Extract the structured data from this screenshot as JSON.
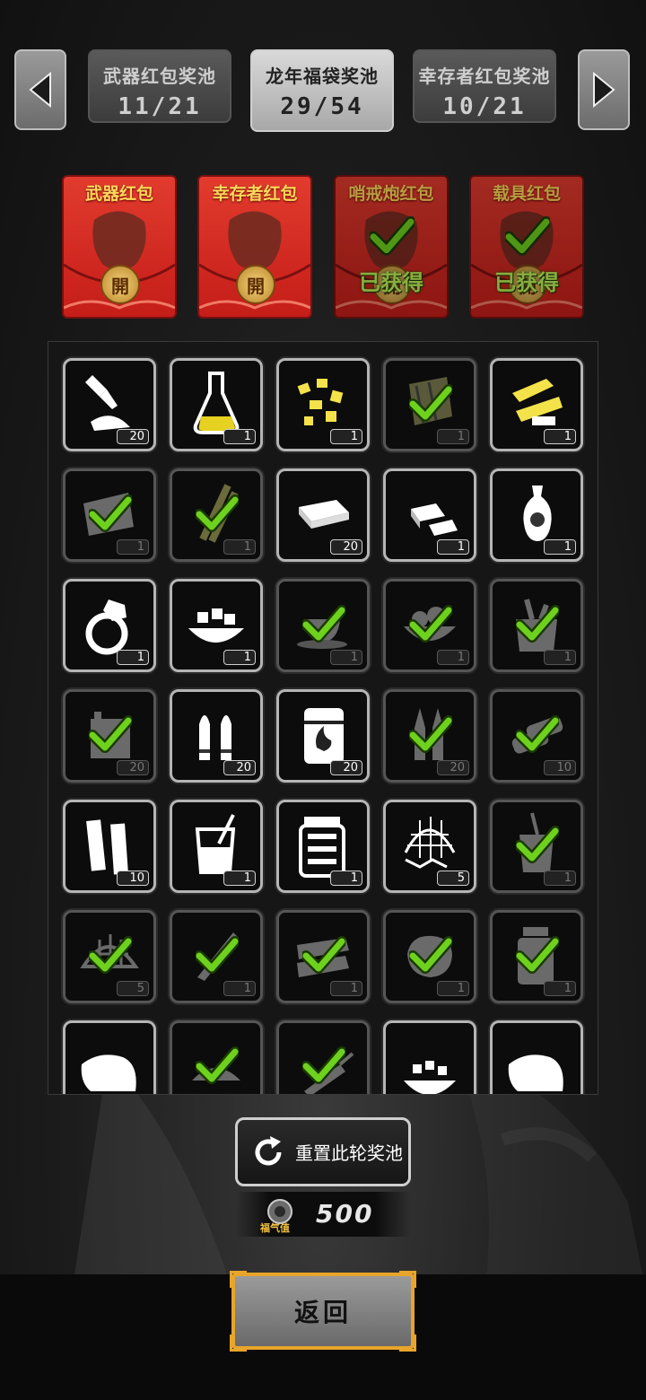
{
  "pools": [
    {
      "name": "武器红包奖池",
      "count": "11/21",
      "active": false
    },
    {
      "name": "龙年福袋奖池",
      "count": "29/54",
      "active": true
    },
    {
      "name": "幸存者红包奖池",
      "count": "10/21",
      "active": false
    }
  ],
  "envelopes": [
    {
      "title": "武器红包",
      "seal": "開",
      "claimed": false
    },
    {
      "title": "幸存者红包",
      "seal": "開",
      "claimed": false
    },
    {
      "title": "哨戒炮红包",
      "seal": "開",
      "claimed": true,
      "claimed_label": "已获得"
    },
    {
      "title": "载具红包",
      "seal": "開",
      "claimed": true,
      "claimed_label": "已获得"
    }
  ],
  "items": [
    {
      "icon": "glue-tube-icon",
      "qty": "20",
      "got": false
    },
    {
      "icon": "flask-icon",
      "qty": "1",
      "got": false
    },
    {
      "icon": "gold-nuggets-icon",
      "qty": "1",
      "got": false
    },
    {
      "icon": "wood-planks-icon",
      "qty": "1",
      "got": true
    },
    {
      "icon": "gold-ornament-icon",
      "qty": "1",
      "got": false
    },
    {
      "icon": "map-icon",
      "qty": "1",
      "got": true
    },
    {
      "icon": "sticks-icon",
      "qty": "1",
      "got": true
    },
    {
      "icon": "cash-bundle-icon",
      "qty": "20",
      "got": false
    },
    {
      "icon": "silver-bars-icon",
      "qty": "1",
      "got": false
    },
    {
      "icon": "vase-icon",
      "qty": "1",
      "got": false
    },
    {
      "icon": "diamond-ring-icon",
      "qty": "1",
      "got": false
    },
    {
      "icon": "sugar-bowl-icon",
      "qty": "1",
      "got": false
    },
    {
      "icon": "coffee-cup-icon",
      "qty": "1",
      "got": true
    },
    {
      "icon": "salad-bowl-icon",
      "qty": "1",
      "got": true
    },
    {
      "icon": "grocery-bag-icon",
      "qty": "1",
      "got": true
    },
    {
      "icon": "battery-icon",
      "qty": "20",
      "got": true
    },
    {
      "icon": "pistol-ammo-icon",
      "qty": "20",
      "got": false
    },
    {
      "icon": "fuel-barrel-icon",
      "qty": "20",
      "got": false
    },
    {
      "icon": "rifle-ammo-icon",
      "qty": "20",
      "got": true
    },
    {
      "icon": "shotgun-shells-icon",
      "qty": "10",
      "got": true
    },
    {
      "icon": "cloth-strips-icon",
      "qty": "10",
      "got": false
    },
    {
      "icon": "juice-glass-icon",
      "qty": "1",
      "got": false
    },
    {
      "icon": "pickle-jar-icon",
      "qty": "1",
      "got": false
    },
    {
      "icon": "fishing-net-icon",
      "qty": "5",
      "got": false
    },
    {
      "icon": "soda-cup-icon",
      "qty": "1",
      "got": true
    },
    {
      "icon": "net-bundle-icon",
      "qty": "5",
      "got": true
    },
    {
      "icon": "knife-icon",
      "qty": "1",
      "got": true
    },
    {
      "icon": "bread-stack-icon",
      "qty": "1",
      "got": true
    },
    {
      "icon": "meat-icon",
      "qty": "1",
      "got": true
    },
    {
      "icon": "pill-bottle-icon",
      "qty": "1",
      "got": true
    },
    {
      "icon": "bandage-icon",
      "qty": "",
      "got": false
    },
    {
      "icon": "dumpling-icon",
      "qty": "",
      "got": true
    },
    {
      "icon": "syringe-icon",
      "qty": "",
      "got": true
    },
    {
      "icon": "rice-bowl-icon",
      "qty": "",
      "got": false
    },
    {
      "icon": "bandage-roll-icon",
      "qty": "",
      "got": false
    }
  ],
  "reset": {
    "label": "重置此轮奖池",
    "icon": "refresh-icon"
  },
  "luck": {
    "icon_label": "福气值",
    "value": "500"
  },
  "back": {
    "label": "返回"
  },
  "colors": {
    "accent": "#e8a52a",
    "envelope_red": "#d62a22",
    "check_green": "#6ed11e",
    "claimed_text": "#bdf05a"
  }
}
